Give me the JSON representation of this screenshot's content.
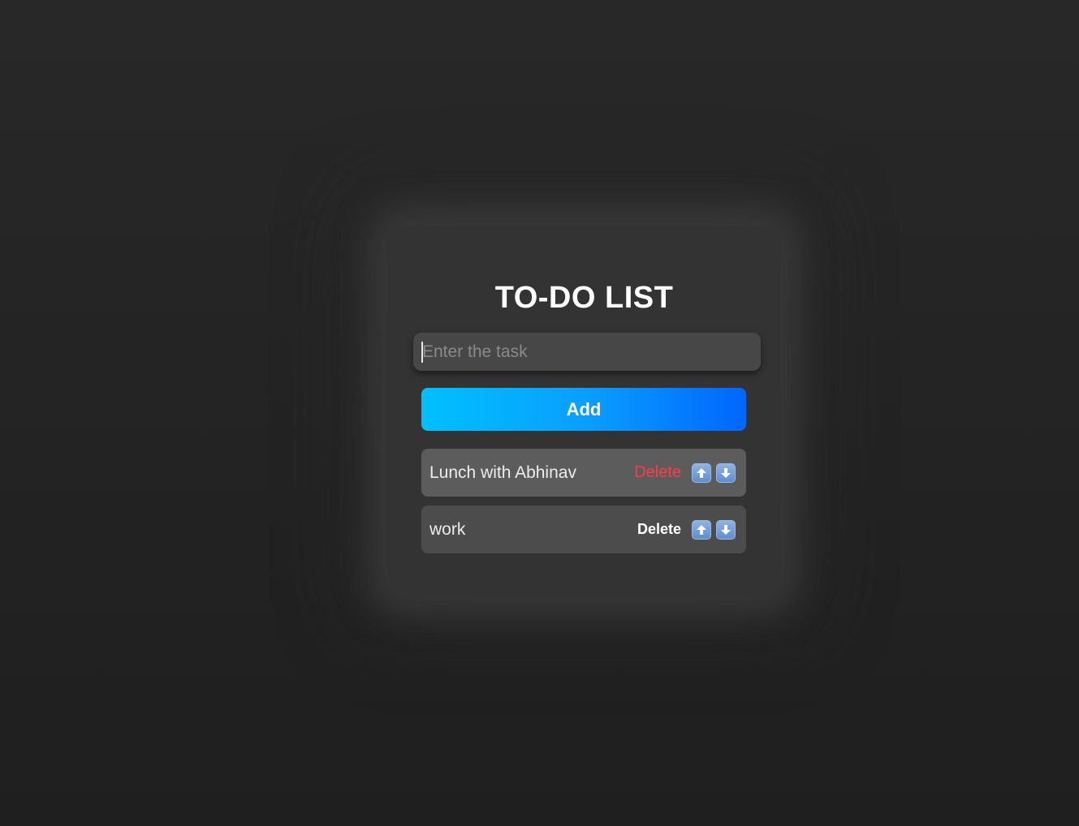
{
  "app": {
    "title": "TO-DO LIST"
  },
  "input": {
    "placeholder": "Enter the task",
    "value": ""
  },
  "add_button": {
    "label": "Add"
  },
  "tasks": [
    {
      "text": "Lunch with Abhinav",
      "delete_label": "Delete",
      "delete_state": "hover",
      "move_up_icon": "arrow-up-icon",
      "move_down_icon": "arrow-down-icon"
    },
    {
      "text": "work",
      "delete_label": "Delete",
      "delete_state": "normal",
      "move_up_icon": "arrow-up-icon",
      "move_down_icon": "arrow-down-icon"
    }
  ],
  "colors": {
    "background": "#252525",
    "card": "#333333",
    "input": "#474747",
    "add_gradient_start": "#00c0ff",
    "add_gradient_end": "#0066ff",
    "task_hover": "#5c5c5c",
    "task_normal": "#4c4c4c",
    "delete_hover": "#ff3b4a",
    "arrow_button": "#6e9ad6"
  }
}
